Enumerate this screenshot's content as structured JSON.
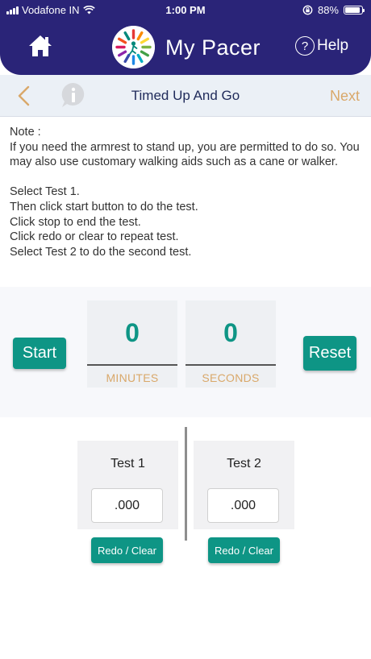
{
  "status_bar": {
    "carrier": "Vodafone IN",
    "time": "1:00 PM",
    "battery": "88%",
    "battery_level": 0.88
  },
  "header": {
    "title": "My Pacer",
    "help_label": "Help",
    "help_glyph": "?"
  },
  "navbar": {
    "title": "Timed Up And Go",
    "next_label": "Next"
  },
  "note": {
    "lines": [
      "Note :",
      "If you need the armrest to stand up, you are permitted to do so. You may also use customary walking aids such as a cane or walker.",
      "",
      "Select Test 1.",
      "Then click start button to do the test.",
      "Click stop to end the test.",
      "Click redo or clear to repeat test.",
      "Select Test 2 to do the second test."
    ]
  },
  "timer": {
    "start_label": "Start",
    "reset_label": "Reset",
    "minutes_value": "0",
    "minutes_label": "MINUTES",
    "seconds_value": "0",
    "seconds_label": "SECONDS"
  },
  "tests": [
    {
      "title": "Test 1",
      "value": ".000",
      "redo_label": "Redo / Clear"
    },
    {
      "title": "Test 2",
      "value": ".000",
      "redo_label": "Redo / Clear"
    }
  ],
  "colors": {
    "header_bg": "#2a2478",
    "accent_green": "#0e9585",
    "accent_tan": "#d9a86a",
    "nav_bg": "#ebf0f6"
  },
  "icons": {
    "home": "home-icon",
    "logo": "my-pacer-logo",
    "help": "help-icon",
    "back": "chevron-left-icon",
    "info": "info-icon"
  }
}
